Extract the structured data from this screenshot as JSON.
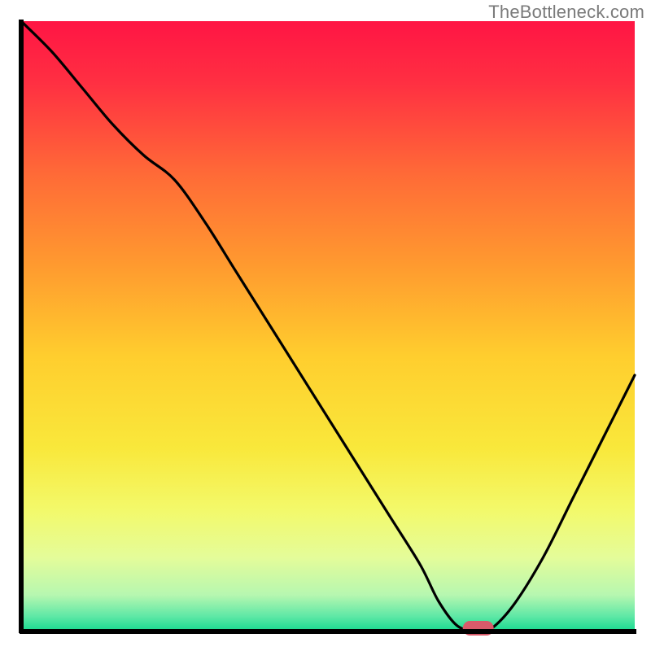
{
  "watermark": "TheBottleneck.com",
  "chart_data": {
    "type": "line",
    "title": "",
    "xlabel": "",
    "ylabel": "",
    "xlim": [
      0,
      100
    ],
    "ylim": [
      0,
      100
    ],
    "x": [
      0,
      5,
      10,
      15,
      20,
      25,
      30,
      35,
      40,
      45,
      50,
      55,
      60,
      65,
      68,
      71,
      74,
      76,
      80,
      85,
      90,
      95,
      100
    ],
    "values": [
      100,
      95,
      89,
      83,
      78,
      74,
      67,
      59,
      51,
      43,
      35,
      27,
      19,
      11,
      5,
      1,
      0,
      0,
      4,
      12,
      22,
      32,
      42
    ],
    "marker": {
      "x": 74.5,
      "y": 0
    },
    "background": {
      "type": "vertical-gradient",
      "stops": [
        {
          "pos": 0.0,
          "color": "#ff1544"
        },
        {
          "pos": 0.1,
          "color": "#ff2f42"
        },
        {
          "pos": 0.25,
          "color": "#ff6a37"
        },
        {
          "pos": 0.4,
          "color": "#ff9a2f"
        },
        {
          "pos": 0.55,
          "color": "#ffce2e"
        },
        {
          "pos": 0.7,
          "color": "#f9e83b"
        },
        {
          "pos": 0.8,
          "color": "#f3f96a"
        },
        {
          "pos": 0.88,
          "color": "#e4fc9a"
        },
        {
          "pos": 0.94,
          "color": "#b7f7b0"
        },
        {
          "pos": 0.975,
          "color": "#5fe8a6"
        },
        {
          "pos": 1.0,
          "color": "#16d98f"
        }
      ]
    },
    "axes": {
      "left": true,
      "bottom": true,
      "top": false,
      "right": false
    }
  }
}
